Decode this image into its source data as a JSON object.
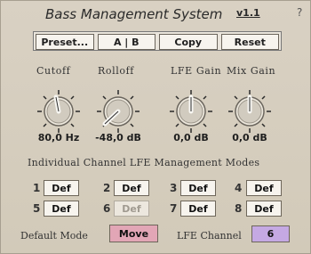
{
  "title": {
    "main": "Bass Management System",
    "version": "v1.1",
    "help": "?"
  },
  "toolbar": {
    "preset": "Preset...",
    "ab": "A | B",
    "copy": "Copy",
    "reset": "Reset"
  },
  "knobs": [
    {
      "label": "Cutoff",
      "value": "80,0 Hz"
    },
    {
      "label": "Rolloff",
      "value": "-48,0 dB"
    },
    {
      "label": "LFE Gain",
      "value": "0,0 dB"
    },
    {
      "label": "Mix Gain",
      "value": "0,0 dB"
    }
  ],
  "section_title": "Individual Channel LFE Management Modes",
  "channels": [
    {
      "num": "1",
      "label": "Def"
    },
    {
      "num": "2",
      "label": "Def"
    },
    {
      "num": "3",
      "label": "Def"
    },
    {
      "num": "4",
      "label": "Def"
    },
    {
      "num": "5",
      "label": "Def"
    },
    {
      "num": "6",
      "label": "Def"
    },
    {
      "num": "7",
      "label": "Def"
    },
    {
      "num": "8",
      "label": "Def"
    }
  ],
  "default_mode": {
    "label": "Default Mode",
    "value": "Move"
  },
  "lfe_channel": {
    "label": "LFE Channel",
    "value": "6"
  },
  "colors": {
    "move": "#e2a6b6",
    "lfe_channel": "#c5a9e3",
    "panel": "#d6cebf"
  }
}
